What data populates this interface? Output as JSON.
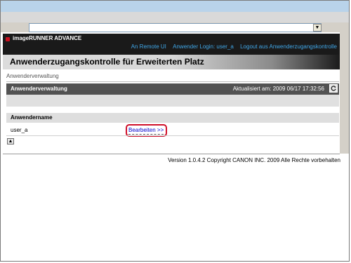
{
  "address": {
    "value": ""
  },
  "header": {
    "brand": "imageRUNNER ADVANCE",
    "nav": {
      "remote_ui": "An Remote UI",
      "login_text": "Anwender Login: user_a",
      "logout": "Logout aus Anwenderzugangskontrolle"
    }
  },
  "page": {
    "title": "Anwenderzugangskontrolle für Erweiterten Platz"
  },
  "breadcrumb": "Anwenderverwaltung",
  "section": {
    "title": "Anwenderverwaltung",
    "updated": "Aktualisiert am: 2009 06/17 17:32:56",
    "refresh_icon": "refresh-icon"
  },
  "table": {
    "column_header": "Anwendername",
    "rows": [
      {
        "username": "user_a",
        "action": "Bearbeiten >>"
      }
    ]
  },
  "footer": {
    "version": "Version 1.0.4.2 Copyright CANON INC. 2009 Alle Rechte vorbehalten"
  },
  "colors": {
    "highlight": "#d0102a",
    "nav": "#40a6e6",
    "header_bg": "#1a1a1a",
    "section_head": "#525252"
  }
}
